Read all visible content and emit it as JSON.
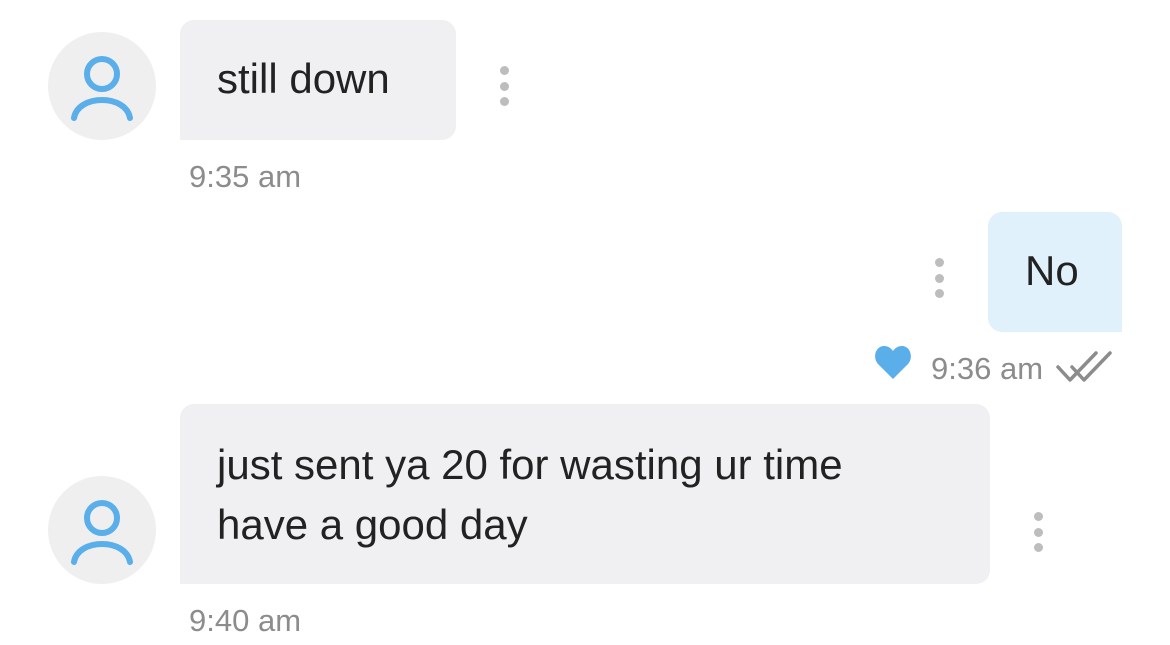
{
  "colors": {
    "accent": "#5aaeea",
    "incoming_bubble": "#f0f0f2",
    "outgoing_bubble": "#e1f1fb",
    "timestamp": "#8c8c8c",
    "avatar_bg": "#efefef"
  },
  "messages": [
    {
      "direction": "incoming",
      "text": "still down",
      "time": "9:35 am",
      "icons": [
        "avatar-person-icon",
        "more-options-icon"
      ]
    },
    {
      "direction": "outgoing",
      "text": "No",
      "time": "9:36 am",
      "liked": true,
      "read": true,
      "icons": [
        "heart-icon",
        "double-check-icon",
        "more-options-icon"
      ]
    },
    {
      "direction": "incoming",
      "text": "just sent ya 20 for wasting ur time\nhave a good day",
      "time": "9:40 am",
      "icons": [
        "avatar-person-icon",
        "more-options-icon"
      ]
    }
  ]
}
